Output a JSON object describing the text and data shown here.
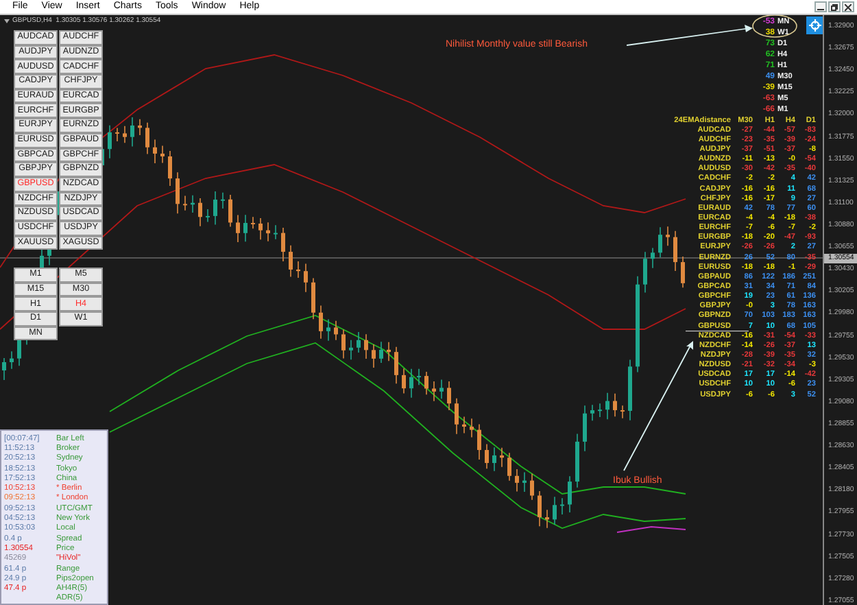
{
  "menu": [
    "File",
    "View",
    "Insert",
    "Charts",
    "Tools",
    "Window",
    "Help"
  ],
  "chart_header": "GBPUSD,H4  1.30305 1.30576 1.30262 1.30554",
  "symbol_buttons": [
    {
      "label": "AUDCAD",
      "selected": false
    },
    {
      "label": "AUDCHF",
      "selected": false
    },
    {
      "label": "AUDJPY",
      "selected": false
    },
    {
      "label": "AUDNZD",
      "selected": false
    },
    {
      "label": "AUDUSD",
      "selected": false
    },
    {
      "label": "CADCHF",
      "selected": false
    },
    {
      "label": "CADJPY",
      "selected": false
    },
    {
      "label": "CHFJPY",
      "selected": false
    },
    {
      "label": "EURAUD",
      "selected": false
    },
    {
      "label": "EURCAD",
      "selected": false
    },
    {
      "label": "EURCHF",
      "selected": false
    },
    {
      "label": "EURGBP",
      "selected": false
    },
    {
      "label": "EURJPY",
      "selected": false
    },
    {
      "label": "EURNZD",
      "selected": false
    },
    {
      "label": "EURUSD",
      "selected": false
    },
    {
      "label": "GBPAUD",
      "selected": false
    },
    {
      "label": "GBPCAD",
      "selected": false
    },
    {
      "label": "GBPCHF",
      "selected": false
    },
    {
      "label": "GBPJPY",
      "selected": false
    },
    {
      "label": "GBPNZD",
      "selected": false
    },
    {
      "label": "GBPUSD",
      "selected": true
    },
    {
      "label": "NZDCAD",
      "selected": false
    },
    {
      "label": "NZDCHF",
      "selected": false
    },
    {
      "label": "NZDJPY",
      "selected": false
    },
    {
      "label": "NZDUSD",
      "selected": false
    },
    {
      "label": "USDCAD",
      "selected": false
    },
    {
      "label": "USDCHF",
      "selected": false
    },
    {
      "label": "USDJPY",
      "selected": false
    },
    {
      "label": "XAUUSD",
      "selected": false
    },
    {
      "label": "XAGUSD",
      "selected": false
    }
  ],
  "timeframe_buttons": [
    {
      "label": "M1",
      "selected": false
    },
    {
      "label": "M5",
      "selected": false
    },
    {
      "label": "M15",
      "selected": false
    },
    {
      "label": "M30",
      "selected": false
    },
    {
      "label": "H1",
      "selected": false
    },
    {
      "label": "H4",
      "selected": true
    },
    {
      "label": "D1",
      "selected": false
    },
    {
      "label": "W1",
      "selected": false
    },
    {
      "label": "MN",
      "selected": false
    }
  ],
  "session_panel": {
    "rows": [
      {
        "value": {
          "text": "[00:07:47]",
          "color": "#5a7aa8"
        },
        "label": {
          "text": "Bar Left",
          "color": "#3a9a3a"
        }
      },
      {
        "value": {
          "text": "11:52:13",
          "color": "#5a7aa8"
        },
        "label": {
          "text": "Broker",
          "color": "#3a9a3a"
        }
      },
      {
        "value": {
          "text": "20:52:13",
          "color": "#5a7aa8"
        },
        "label": {
          "text": "Sydney",
          "color": "#3a9a3a"
        }
      },
      {
        "value": {
          "text": "18:52:13",
          "color": "#5a7aa8"
        },
        "label": {
          "text": "Tokyo",
          "color": "#3a9a3a"
        }
      },
      {
        "value": {
          "text": "17:52:13",
          "color": "#5a7aa8"
        },
        "label": {
          "text": "China",
          "color": "#3a9a3a"
        }
      },
      {
        "value": {
          "text": "10:52:13",
          "color": "#f04030"
        },
        "label": {
          "text": "* Berlin",
          "color": "#f04030"
        }
      },
      {
        "value": {
          "text": "09:52:13",
          "color": "#f07030"
        },
        "label": {
          "text": "* London",
          "color": "#f04030"
        }
      },
      {
        "value": {
          "text": "09:52:13",
          "color": "#5a7aa8"
        },
        "label": {
          "text": "UTC/GMT",
          "color": "#3a9a3a"
        }
      },
      {
        "value": {
          "text": "04:52:13",
          "color": "#5a7aa8"
        },
        "label": {
          "text": "New York",
          "color": "#3a9a3a"
        }
      },
      {
        "value": {
          "text": "10:53:03",
          "color": "#5a7aa8"
        },
        "label": {
          "text": "Local",
          "color": "#3a9a3a"
        }
      },
      {
        "value": {
          "text": "0.4 p",
          "color": "#5a7aa8"
        },
        "label": {
          "text": "Spread",
          "color": "#3a9a3a"
        }
      },
      {
        "value": {
          "text": "1.30554",
          "color": "#e82020"
        },
        "label": {
          "text": "Price",
          "color": "#3a9a3a"
        }
      },
      {
        "value": {
          "text": "45269",
          "color": "#8a8a9a"
        },
        "label": {
          "text": "\"HiVol\"",
          "color": "#e82020"
        }
      },
      {
        "value": {
          "text": "61.4 p",
          "color": "#5a7aa8"
        },
        "label": {
          "text": "Range",
          "color": "#3a9a3a"
        }
      },
      {
        "value": {
          "text": "24.9 p",
          "color": "#5a7aa8"
        },
        "label": {
          "text": "Pips2open",
          "color": "#3a9a3a"
        }
      },
      {
        "value": {
          "text": "47.4 p",
          "color": "#e82020"
        },
        "label": {
          "text": "AH4R(5)",
          "color": "#3a9a3a"
        }
      },
      {
        "label": {
          "text": "ADR(5)",
          "color": "#3a9a3a"
        }
      }
    ]
  },
  "mtf_indicator": [
    {
      "reading": "-53",
      "timeframe": "MN",
      "color": "#d23cd2"
    },
    {
      "reading": "38",
      "timeframe": "W1",
      "color": "#e8d800"
    },
    {
      "reading": "73",
      "timeframe": "D1",
      "color": "#22c022"
    },
    {
      "reading": "62",
      "timeframe": "H4",
      "color": "#22c022"
    },
    {
      "reading": "71",
      "timeframe": "H1",
      "color": "#22c022"
    },
    {
      "reading": "49",
      "timeframe": "M30",
      "color": "#3c8ff0"
    },
    {
      "reading": "-39",
      "timeframe": "M15",
      "color": "#e8d800"
    },
    {
      "reading": "-63",
      "timeframe": "M5",
      "color": "#e8383a"
    },
    {
      "reading": "-66",
      "timeframe": "M1",
      "color": "#e8383a"
    }
  ],
  "annotations": [
    "Nihilist Monthly value still Bearish",
    "Ibuk Bullish"
  ],
  "ema_table": {
    "title": "24EMAdistance",
    "columns": [
      "M30",
      "H1",
      "H4",
      "D1"
    ],
    "rows": [
      {
        "pair": "AUDCAD",
        "cells": [
          {
            "text": "-27",
            "color": "#e8383a"
          },
          {
            "text": "-44",
            "color": "#e8383a"
          },
          {
            "text": "-57",
            "color": "#e8383a"
          },
          {
            "text": "-83",
            "color": "#e8383a"
          }
        ]
      },
      {
        "pair": "AUDCHF",
        "cells": [
          {
            "text": "-23",
            "color": "#e8383a"
          },
          {
            "text": "-35",
            "color": "#e8383a"
          },
          {
            "text": "-39",
            "color": "#e8383a"
          },
          {
            "text": "-24",
            "color": "#e8383a"
          }
        ]
      },
      {
        "pair": "AUDJPY",
        "cells": [
          {
            "text": "-37",
            "color": "#e8383a"
          },
          {
            "text": "-51",
            "color": "#e8383a"
          },
          {
            "text": "-37",
            "color": "#e8383a"
          },
          {
            "text": "-8",
            "color": "#f2e600"
          }
        ]
      },
      {
        "pair": "AUDNZD",
        "cells": [
          {
            "text": "-11",
            "color": "#f2e600"
          },
          {
            "text": "-13",
            "color": "#f2e600"
          },
          {
            "text": "-0",
            "color": "#f2e600"
          },
          {
            "text": "-54",
            "color": "#e8383a"
          }
        ]
      },
      {
        "pair": "AUDUSD",
        "cells": [
          {
            "text": "-30",
            "color": "#e8383a"
          },
          {
            "text": "-42",
            "color": "#e8383a"
          },
          {
            "text": "-35",
            "color": "#e8383a"
          },
          {
            "text": "-40",
            "color": "#e8383a"
          }
        ]
      },
      {
        "pair": "CADCHF",
        "cells": [
          {
            "text": "-2",
            "color": "#f2e600"
          },
          {
            "text": "-2",
            "color": "#f2e600"
          },
          {
            "text": "4",
            "color": "#1ee6ff"
          },
          {
            "text": "42",
            "color": "#3c8ff0"
          }
        ]
      },
      {
        "pair": "CADJPY",
        "cells": [
          {
            "text": "-16",
            "color": "#f2e600"
          },
          {
            "text": "-16",
            "color": "#f2e600"
          },
          {
            "text": "11",
            "color": "#1ee6ff"
          },
          {
            "text": "68",
            "color": "#3c8ff0"
          }
        ]
      },
      {
        "pair": "CHFJPY",
        "cells": [
          {
            "text": "-16",
            "color": "#f2e600"
          },
          {
            "text": "-17",
            "color": "#f2e600"
          },
          {
            "text": "9",
            "color": "#1ee6ff"
          },
          {
            "text": "27",
            "color": "#3c8ff0"
          }
        ]
      },
      {
        "pair": "EURAUD",
        "cells": [
          {
            "text": "42",
            "color": "#3c8ff0"
          },
          {
            "text": "78",
            "color": "#3c8ff0"
          },
          {
            "text": "77",
            "color": "#3c8ff0"
          },
          {
            "text": "60",
            "color": "#3c8ff0"
          }
        ]
      },
      {
        "pair": "EURCAD",
        "cells": [
          {
            "text": "-4",
            "color": "#f2e600"
          },
          {
            "text": "-4",
            "color": "#f2e600"
          },
          {
            "text": "-18",
            "color": "#f2e600"
          },
          {
            "text": "-38",
            "color": "#e8383a"
          }
        ]
      },
      {
        "pair": "EURCHF",
        "cells": [
          {
            "text": "-7",
            "color": "#f2e600"
          },
          {
            "text": "-6",
            "color": "#f2e600"
          },
          {
            "text": "-7",
            "color": "#f2e600"
          },
          {
            "text": "-2",
            "color": "#f2e600"
          }
        ]
      },
      {
        "pair": "EURGBP",
        "cells": [
          {
            "text": "-18",
            "color": "#f2e600"
          },
          {
            "text": "-20",
            "color": "#f2e600"
          },
          {
            "text": "-47",
            "color": "#e8383a"
          },
          {
            "text": "-93",
            "color": "#e8383a"
          }
        ]
      },
      {
        "pair": "EURJPY",
        "cells": [
          {
            "text": "-26",
            "color": "#e8383a"
          },
          {
            "text": "-26",
            "color": "#e8383a"
          },
          {
            "text": "2",
            "color": "#1ee6ff"
          },
          {
            "text": "27",
            "color": "#3c8ff0"
          }
        ]
      },
      {
        "pair": "EURNZD",
        "cells": [
          {
            "text": "26",
            "color": "#3c8ff0"
          },
          {
            "text": "52",
            "color": "#3c8ff0"
          },
          {
            "text": "80",
            "color": "#3c8ff0"
          },
          {
            "text": "-35",
            "color": "#e8383a"
          }
        ]
      },
      {
        "pair": "EURUSD",
        "cells": [
          {
            "text": "-18",
            "color": "#f2e600"
          },
          {
            "text": "-18",
            "color": "#f2e600"
          },
          {
            "text": "-1",
            "color": "#f2e600"
          },
          {
            "text": "-29",
            "color": "#e8383a"
          }
        ]
      },
      {
        "pair": "GBPAUD",
        "cells": [
          {
            "text": "86",
            "color": "#3c8ff0"
          },
          {
            "text": "122",
            "color": "#3c8ff0"
          },
          {
            "text": "186",
            "color": "#3c8ff0"
          },
          {
            "text": "251",
            "color": "#3c8ff0"
          }
        ]
      },
      {
        "pair": "GBPCAD",
        "cells": [
          {
            "text": "31",
            "color": "#3c8ff0"
          },
          {
            "text": "34",
            "color": "#3c8ff0"
          },
          {
            "text": "71",
            "color": "#3c8ff0"
          },
          {
            "text": "84",
            "color": "#3c8ff0"
          }
        ]
      },
      {
        "pair": "GBPCHF",
        "cells": [
          {
            "text": "19",
            "color": "#1ee6ff"
          },
          {
            "text": "23",
            "color": "#3c8ff0"
          },
          {
            "text": "61",
            "color": "#3c8ff0"
          },
          {
            "text": "136",
            "color": "#3c8ff0"
          }
        ]
      },
      {
        "pair": "GBPJPY",
        "cells": [
          {
            "text": "-0",
            "color": "#f2e600"
          },
          {
            "text": "3",
            "color": "#1ee6ff"
          },
          {
            "text": "78",
            "color": "#3c8ff0"
          },
          {
            "text": "163",
            "color": "#3c8ff0"
          }
        ]
      },
      {
        "pair": "GBPNZD",
        "cells": [
          {
            "text": "70",
            "color": "#3c8ff0"
          },
          {
            "text": "103",
            "color": "#3c8ff0"
          },
          {
            "text": "183",
            "color": "#3c8ff0"
          },
          {
            "text": "163",
            "color": "#3c8ff0"
          }
        ]
      },
      {
        "pair": "GBPUSD",
        "cells": [
          {
            "text": "7",
            "color": "#1ee6ff"
          },
          {
            "text": "10",
            "color": "#1ee6ff"
          },
          {
            "text": "68",
            "color": "#3c8ff0"
          },
          {
            "text": "105",
            "color": "#3c8ff0"
          }
        ]
      },
      {
        "pair": "NZDCAD",
        "cells": [
          {
            "text": "-16",
            "color": "#f2e600"
          },
          {
            "text": "-31",
            "color": "#e8383a"
          },
          {
            "text": "-54",
            "color": "#e8383a"
          },
          {
            "text": "-33",
            "color": "#e8383a"
          }
        ]
      },
      {
        "pair": "NZDCHF",
        "cells": [
          {
            "text": "-14",
            "color": "#f2e600"
          },
          {
            "text": "-26",
            "color": "#e8383a"
          },
          {
            "text": "-37",
            "color": "#e8383a"
          },
          {
            "text": "13",
            "color": "#1ee6ff"
          }
        ]
      },
      {
        "pair": "NZDJPY",
        "cells": [
          {
            "text": "-28",
            "color": "#e8383a"
          },
          {
            "text": "-39",
            "color": "#e8383a"
          },
          {
            "text": "-35",
            "color": "#e8383a"
          },
          {
            "text": "32",
            "color": "#3c8ff0"
          }
        ]
      },
      {
        "pair": "NZDUSD",
        "cells": [
          {
            "text": "-21",
            "color": "#e8383a"
          },
          {
            "text": "-32",
            "color": "#e8383a"
          },
          {
            "text": "-34",
            "color": "#e8383a"
          },
          {
            "text": "-3",
            "color": "#f2e600"
          }
        ]
      },
      {
        "pair": "USDCAD",
        "cells": [
          {
            "text": "17",
            "color": "#1ee6ff"
          },
          {
            "text": "17",
            "color": "#1ee6ff"
          },
          {
            "text": "-14",
            "color": "#f2e600"
          },
          {
            "text": "-42",
            "color": "#e8383a"
          }
        ]
      },
      {
        "pair": "USDCHF",
        "cells": [
          {
            "text": "10",
            "color": "#1ee6ff"
          },
          {
            "text": "10",
            "color": "#1ee6ff"
          },
          {
            "text": "-6",
            "color": "#f2e600"
          },
          {
            "text": "23",
            "color": "#3c8ff0"
          }
        ]
      },
      {
        "pair": "USDJPY",
        "cells": [
          {
            "text": "-6",
            "color": "#f2e600"
          },
          {
            "text": "-6",
            "color": "#f2e600"
          },
          {
            "text": "3",
            "color": "#1ee6ff"
          },
          {
            "text": "52",
            "color": "#3c8ff0"
          }
        ]
      }
    ]
  },
  "price_axis": {
    "labels": [
      "1.32900",
      "1.32675",
      "1.32450",
      "1.32225",
      "1.32000",
      "1.31775",
      "1.31550",
      "1.31325",
      "1.31100",
      "1.30880",
      "1.30655",
      "1.30430",
      "1.30205",
      "1.29980",
      "1.29755",
      "1.29530",
      "1.29305",
      "1.29080",
      "1.28855",
      "1.28630",
      "1.28405",
      "1.28180",
      "1.27955",
      "1.27730",
      "1.27505",
      "1.27280",
      "1.27055"
    ],
    "current": "1.30554"
  }
}
